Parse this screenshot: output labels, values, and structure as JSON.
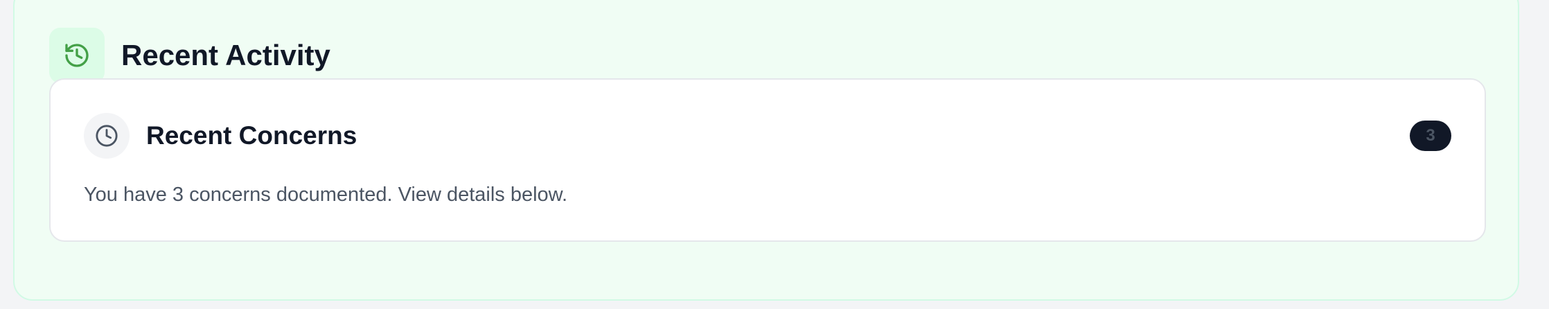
{
  "section": {
    "title": "Recent Activity",
    "icon": "history-icon",
    "accent_color": "#43a047"
  },
  "card": {
    "title": "Recent Concerns",
    "icon": "clock-icon",
    "badge_count": "3",
    "description": "You have 3 concerns documented. View details below."
  }
}
